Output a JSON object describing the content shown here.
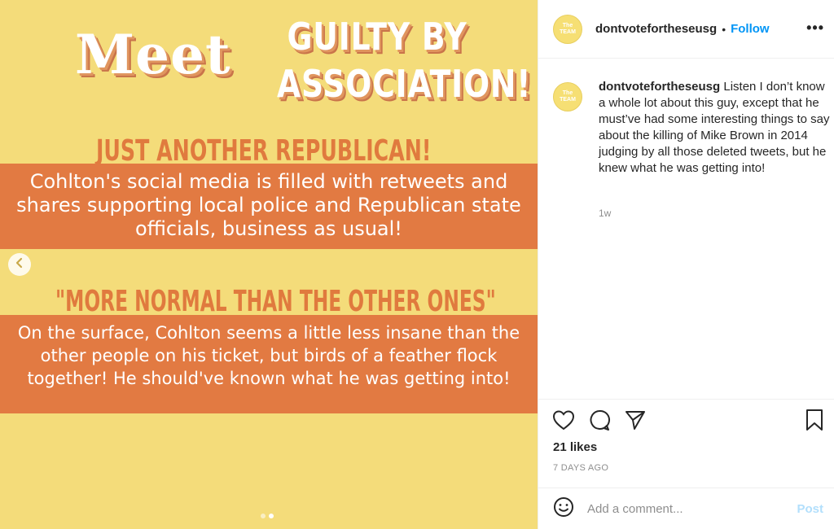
{
  "media": {
    "title_meet": "Meet",
    "title_guilty": "GUILTY BY ASSOCIATION!",
    "heading_1": "JUST ANOTHER REPUBLICAN!",
    "band_1": "Cohlton's social media is filled with retweets and shares supporting local police and Republican state officials, business as usual!",
    "heading_2": "\"MORE NORMAL THAN THE OTHER ONES\"",
    "band_2": "On the surface, Cohlton seems a little less insane than the other people on his ticket, but birds of a feather flock together! He should've known what he was getting into!",
    "colors": {
      "background": "#f4dc7a",
      "band": "#e27a42",
      "heading": "#e07a3e"
    },
    "carousel_dots": 2,
    "carousel_active": 2
  },
  "header": {
    "username": "dontvotefortheseusg",
    "separator": "•",
    "follow_label": "Follow",
    "more_icon": "more-horizontal-icon",
    "avatar_text": "The TEAM"
  },
  "caption": {
    "username": "dontvotefortheseusg",
    "text": "Listen I don’t know a whole lot about this guy, except that he must’ve had some interesting things to say about the killing of Mike Brown in 2014 judging by all those deleted tweets, but he knew what he was getting into!",
    "time": "1w"
  },
  "actions": {
    "likes": "21 likes",
    "date": "7 DAYS AGO",
    "comment_placeholder": "Add a comment...",
    "post_label": "Post",
    "accent": "#0095f6"
  }
}
